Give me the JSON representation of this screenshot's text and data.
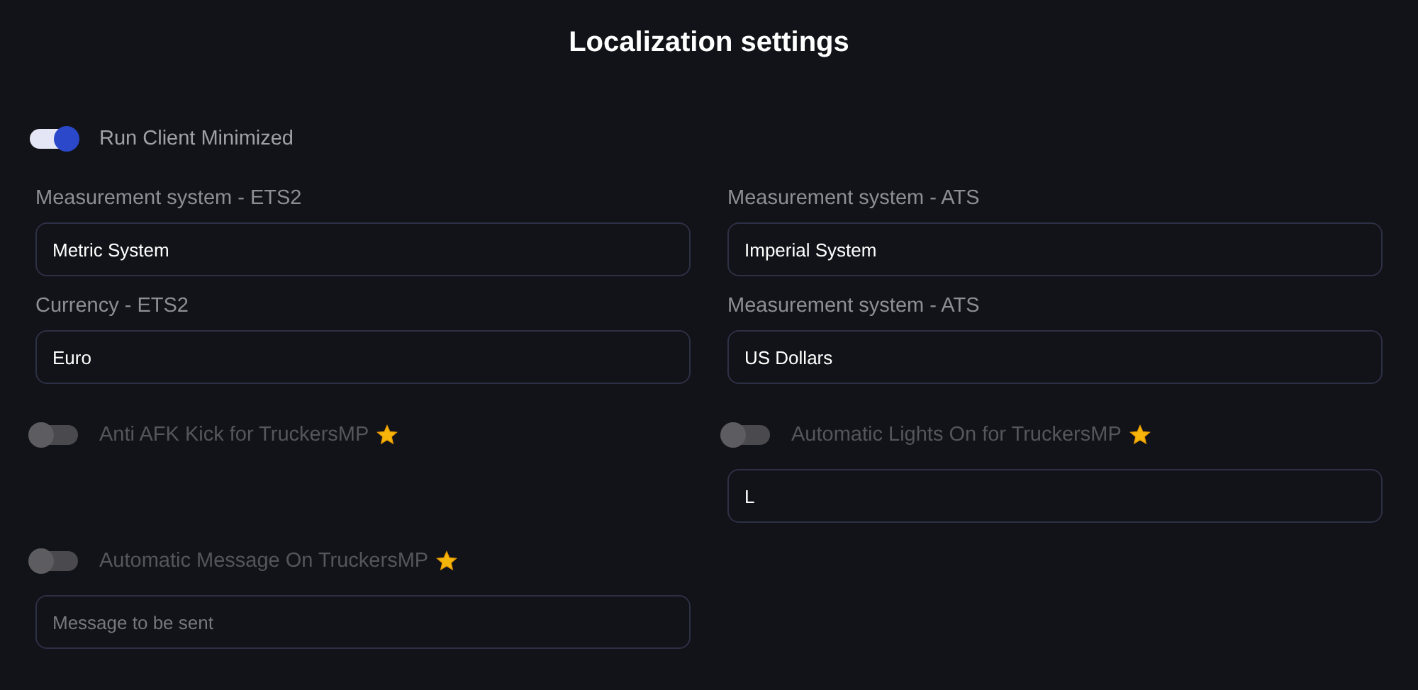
{
  "title": "Localization settings",
  "run_minimized": {
    "label": "Run Client Minimized",
    "on": true
  },
  "fields": [
    {
      "label": "Measurement system - ETS2",
      "value": "Metric System"
    },
    {
      "label": "Measurement system - ATS",
      "value": "Imperial System"
    },
    {
      "label": "Currency - ETS2",
      "value": "Euro"
    },
    {
      "label": "Measurement system - ATS",
      "value": "US Dollars"
    }
  ],
  "features": [
    {
      "label": "Anti AFK Kick for TruckersMP",
      "on": false
    },
    {
      "label": "Automatic Lights On for TruckersMP",
      "on": false,
      "input": {
        "value": "L"
      }
    },
    {
      "label": "Automatic Message On TruckersMP",
      "on": false,
      "input": {
        "placeholder": "Message to be sent"
      }
    }
  ]
}
